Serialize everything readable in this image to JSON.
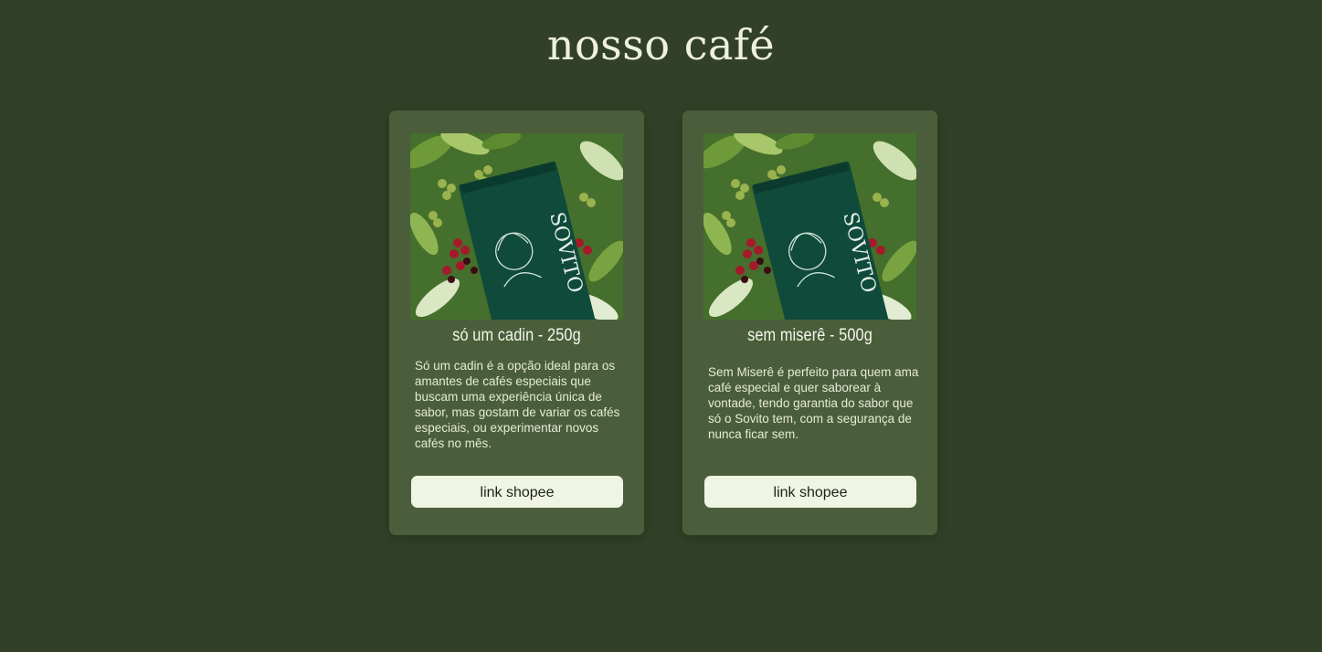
{
  "page": {
    "title": "nosso café"
  },
  "products": [
    {
      "title": "só um cadin - 250g",
      "description": "Só um cadin é a opção ideal para os amantes de cafés especiais que buscam uma experiência única de sabor, mas gostam de variar os cafés especiais, ou experimentar novos cafés no mês.",
      "button_label": "link shopee",
      "image_icon": "coffee-bag-photo"
    },
    {
      "title": "sem miserê - 500g",
      "description": "Sem Miserê é perfeito para quem ama café especial e quer saborear à vontade, tendo garantia do sabor que só o Sovito tem, com a segurança de nunca ficar sem.",
      "button_label": "link shopee",
      "image_icon": "coffee-bag-photo"
    }
  ],
  "colors": {
    "background": "#324027",
    "card": "#4a5e3b",
    "button": "#f0f4e3",
    "title_text": "#eef1de"
  }
}
